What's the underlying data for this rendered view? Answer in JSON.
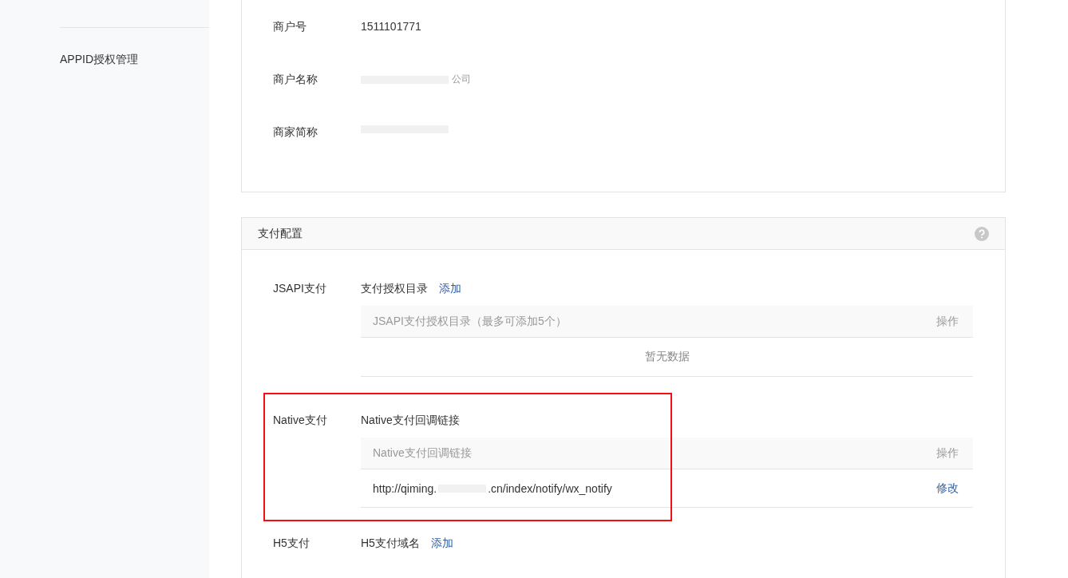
{
  "sidebar": {
    "items": [
      {
        "label": "APPID授权管理",
        "selected": false
      }
    ]
  },
  "merchant_info": {
    "rows": [
      {
        "label": "商户号",
        "value": "1511101771",
        "redacted": false
      },
      {
        "label": "商户名称",
        "value": "公司",
        "redacted": true
      },
      {
        "label": "商家简称",
        "redacted": true
      }
    ]
  },
  "payment_config": {
    "title": "支付配置",
    "sections": [
      {
        "label": "JSAPI支付",
        "subtitle": "支付授权目录",
        "add_link": "添加",
        "highlighted": false,
        "table": {
          "columns": [
            "JSAPI支付授权目录（最多可添加5个）",
            "操作"
          ],
          "empty_text": "暂无数据"
        }
      },
      {
        "label": "Native支付",
        "subtitle": "Native支付回调链接",
        "highlighted": true,
        "table": {
          "columns": [
            "Native支付回调链接",
            "操作"
          ],
          "rows": [
            {
              "url_start": "http://qiming.",
              "url_end": ".cn/index/notify/wx_notify",
              "action": "修改"
            }
          ]
        }
      },
      {
        "label": "H5支付",
        "subtitle": "H5支付域名",
        "add_link": "添加",
        "highlighted": false
      }
    ]
  }
}
